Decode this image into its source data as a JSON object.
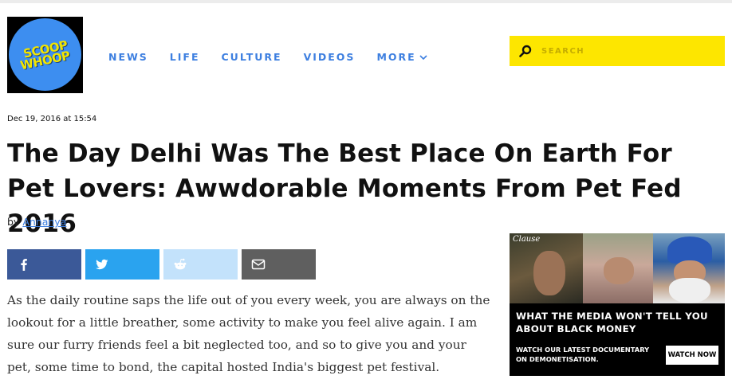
{
  "brand": {
    "logo_line1": "SCOOP",
    "logo_line2": "WHOOP"
  },
  "nav": {
    "items": [
      {
        "label": "NEWS"
      },
      {
        "label": "LIFE"
      },
      {
        "label": "CULTURE"
      },
      {
        "label": "VIDEOS"
      },
      {
        "label": "MORE"
      }
    ]
  },
  "search": {
    "placeholder": "SEARCH"
  },
  "article": {
    "date": "Dec 19, 2016 at 15:54",
    "title": "The Day Delhi Was The Best Place On Earth For Pet Lovers: Awwdorable Moments From Pet Fed 2016",
    "by_prefix": "by",
    "author": "Annanya",
    "body": "As the daily routine saps the life out of you every week, you are always on the lookout for a little breather, some activity to make you feel alive again. I am sure our furry friends feel a bit neglected too, and so to give you and your pet, some time to bond, the capital hosted India's biggest pet festival."
  },
  "share": {
    "buttons": [
      {
        "icon": "facebook-icon",
        "color": "#3b5998"
      },
      {
        "icon": "twitter-icon",
        "color": "#2aa3ef"
      },
      {
        "icon": "reddit-icon",
        "color": "#c3e2fb"
      },
      {
        "icon": "email-icon",
        "color": "#5f5f5f"
      }
    ]
  },
  "ad": {
    "brand": "Clause",
    "headline": "WHAT THE MEDIA WON'T TELL YOU ABOUT BLACK MONEY",
    "sub": "WATCH OUR LATEST DOCUMENTARY ON DEMONETISATION.",
    "cta": "WATCH NOW"
  },
  "colors": {
    "accent": "#3d7fe0",
    "search_bg": "#fde600",
    "logo_bg": "#3d8ef0",
    "logo_text": "#f2e600"
  }
}
